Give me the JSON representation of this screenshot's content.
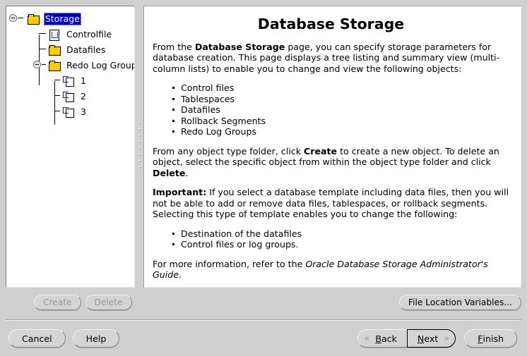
{
  "tree": {
    "nodes": [
      {
        "label": "Storage",
        "icon": "folder-icon",
        "selected": true,
        "expanded": true,
        "level": 0
      },
      {
        "label": "Controlfile",
        "icon": "controlfile-icon",
        "selected": false,
        "level": 1
      },
      {
        "label": "Datafiles",
        "icon": "folder-icon",
        "selected": false,
        "level": 1
      },
      {
        "label": "Redo Log Groups",
        "icon": "folder-icon",
        "selected": false,
        "expanded": true,
        "level": 1
      },
      {
        "label": "1",
        "icon": "log-group-icon",
        "selected": false,
        "level": 2
      },
      {
        "label": "2",
        "icon": "log-group-icon",
        "selected": false,
        "level": 2
      },
      {
        "label": "3",
        "icon": "log-group-icon",
        "selected": false,
        "level": 2
      }
    ]
  },
  "doc": {
    "title": "Database Storage",
    "para1_a": "From the ",
    "para1_b": "Database Storage",
    "para1_c": " page, you can specify storage parameters for database creation. This page displays a tree listing and summary view (multi-column lists) to enable you to change and view the following objects:",
    "list1": [
      "Control files",
      "Tablespaces",
      "Datafiles",
      "Rollback Segments",
      "Redo Log Groups"
    ],
    "para2_a": "From any object type folder, click ",
    "para2_b": "Create",
    "para2_c": " to create a new object. To delete an object, select the specific object from within the object type folder and click ",
    "para2_d": "Delete",
    "para2_e": ".",
    "para3_a": "Important:",
    "para3_b": " If you select a database template including data files, then you will not be able to add or remove data files, tablespaces, or rollback segments. Selecting this type of template enables you to change the following:",
    "list2": [
      "Destination of the datafiles",
      "Control files or log groups."
    ],
    "para4_a": "For more information, refer to the ",
    "para4_b": "Oracle Database Storage Administrator's Guide",
    "para4_c": "."
  },
  "toolbar": {
    "create_label": "Create",
    "delete_label": "Delete",
    "file_location_label": "File Location Variables..."
  },
  "nav": {
    "cancel_label": "Cancel",
    "help_label": "Help",
    "back_mnemonic": "B",
    "back_rest": "ack",
    "next_mnemonic": "N",
    "next_rest": "ext",
    "finish_mnemonic": "F",
    "finish_rest": "inish",
    "back_chevron": "«",
    "next_chevron": "»"
  },
  "colors": {
    "selection": "#0000c8",
    "folder": "#ffcc00",
    "window_bg": "#d0d0d0",
    "panel_bg": "#ffffff"
  }
}
